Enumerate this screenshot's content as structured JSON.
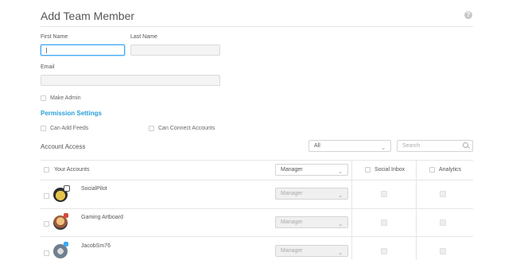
{
  "page": {
    "title": "Add Team Member",
    "help_icon": "question-circle-icon"
  },
  "form": {
    "first_name_label": "First Name",
    "first_name_value": "",
    "last_name_label": "Last Name",
    "last_name_value": "",
    "email_label": "Email",
    "email_value": "",
    "make_admin_label": "Make Admin"
  },
  "permissions": {
    "heading": "Permission Settings",
    "can_add_feeds": "Can Add Feeds",
    "can_connect_accounts": "Can Connect Accounts"
  },
  "access": {
    "heading": "Account Access",
    "filter_value": "All",
    "search_placeholder": "Search",
    "header": {
      "your_accounts": "Your Accounts",
      "role": "Manager",
      "social_inbox": "Social Inbox",
      "analytics": "Analytics"
    },
    "rows": [
      {
        "name": "SocialPilot",
        "role": "Manager"
      },
      {
        "name": "Gaming Artboard",
        "role": "Manager"
      },
      {
        "name": "JacobSm76",
        "role": "Manager"
      }
    ]
  },
  "colors": {
    "accent": "#2a9fd8",
    "focus_border": "#3fa9f5"
  }
}
